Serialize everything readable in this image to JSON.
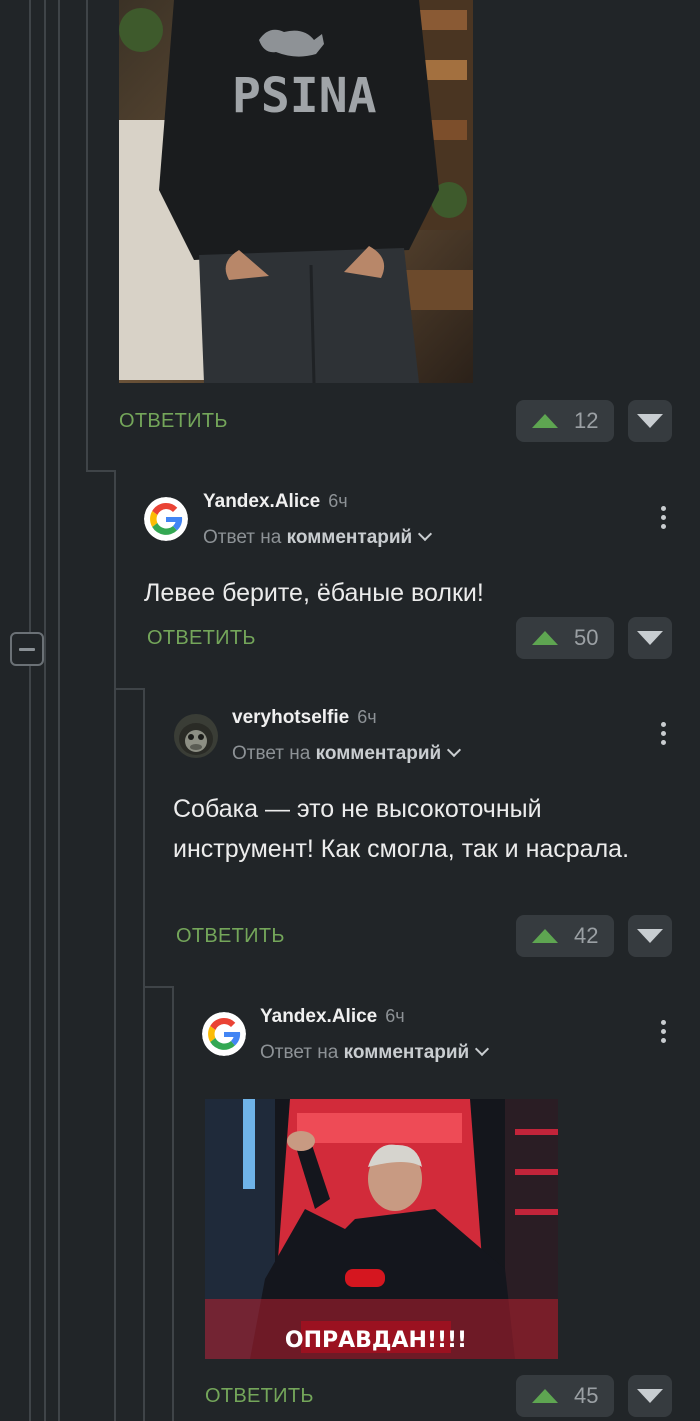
{
  "thread": [
    {
      "id": "c0",
      "reply_label": "ОТВЕТИТЬ",
      "votes": "12",
      "image": {
        "shirt_text": "PSINA"
      }
    },
    {
      "id": "c1",
      "author": "Yandex.Alice",
      "time": "6ч",
      "reply_to_prefix": "Ответ на",
      "reply_to_link": "комментарий",
      "text": "Левее берите, ёбаные волки!",
      "reply_label": "ОТВЕТИТЬ",
      "votes": "50"
    },
    {
      "id": "c2",
      "author": "veryhotselfie",
      "time": "6ч",
      "reply_to_prefix": "Ответ на",
      "reply_to_link": "комментарий",
      "text": "Собака — это не высокоточный инструмент! Как смогла, так и насрала.",
      "reply_label": "ОТВЕТИТЬ",
      "votes": "42"
    },
    {
      "id": "c3",
      "author": "Yandex.Alice",
      "time": "6ч",
      "reply_to_prefix": "Ответ на",
      "reply_to_link": "комментарий",
      "image": {
        "caption": "ОПРАВДАН!!!!"
      },
      "reply_label": "ОТВЕТИТЬ",
      "votes": "45"
    }
  ],
  "colors": {
    "background": "#212528",
    "reply_green": "#74a65a",
    "upvote_green": "#5ea551",
    "vote_bg": "#363b3f"
  }
}
